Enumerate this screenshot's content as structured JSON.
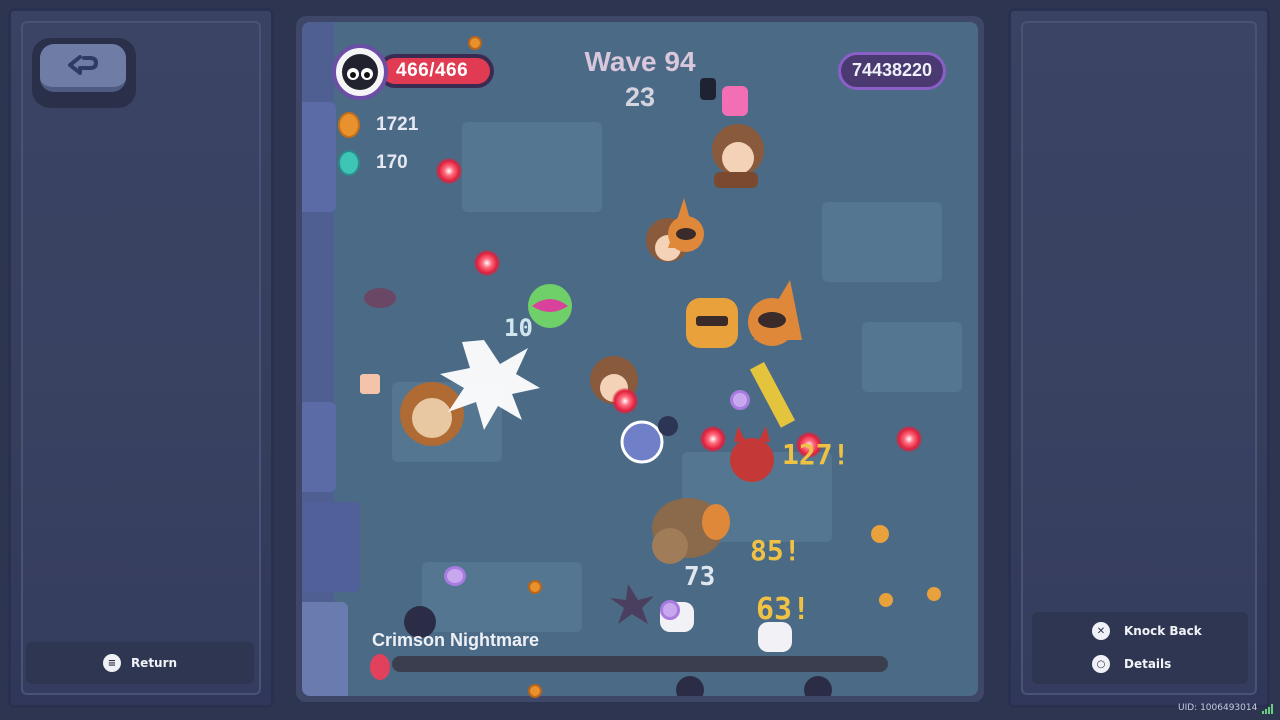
{
  "left_panel": {
    "return_label": "Return",
    "return_button_glyph": "≡"
  },
  "right_panel": {
    "knock_back_label": "Knock Back",
    "knock_back_glyph": "✕",
    "details_label": "Details",
    "details_glyph": "○"
  },
  "uid": "UID: 1006493014",
  "hud": {
    "hp": "466/466",
    "coins": "1721",
    "gems": "170",
    "wave_label": "Wave 94",
    "wave_timer": "23",
    "score": "74438220",
    "boss_name": "Crimson Nightmare"
  },
  "damage_numbers": [
    {
      "text": "10",
      "color": "#cfe6ef"
    },
    {
      "text": "127!",
      "color": "#f0c243"
    },
    {
      "text": "85!",
      "color": "#f0c243"
    },
    {
      "text": "73",
      "color": "#dfe6ee"
    },
    {
      "text": "63!",
      "color": "#f0c243"
    }
  ],
  "colors": {
    "hp_bar": "#e03b52",
    "score_border": "#8a5fc7",
    "bullet": "#e0203c",
    "crit_text": "#f0c243"
  },
  "icons": [
    "back-arrow-icon",
    "menu-icon",
    "x-button-icon",
    "circle-button-icon",
    "coin-icon",
    "gem-icon",
    "boss-icon"
  ]
}
